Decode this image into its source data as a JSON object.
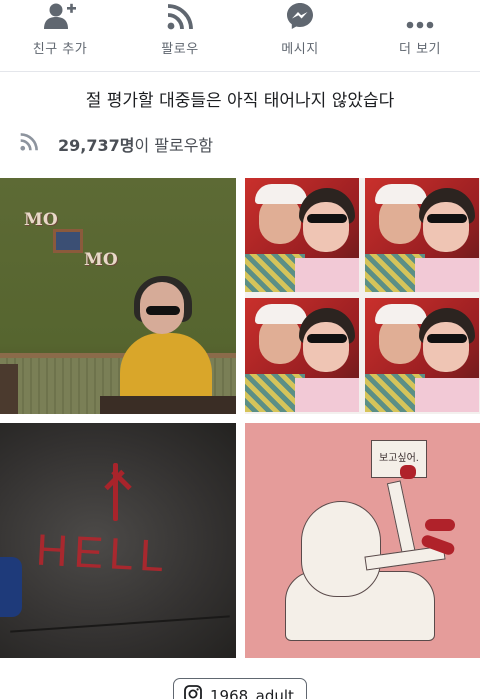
{
  "actions": [
    {
      "label": "친구 추가",
      "icon": "add-friend-icon"
    },
    {
      "label": "팔로우",
      "icon": "follow-rss-icon"
    },
    {
      "label": "메시지",
      "icon": "messenger-icon"
    },
    {
      "label": "더 보기",
      "icon": "more-dots-icon"
    }
  ],
  "page": {
    "description": "절 평가할 대중들은 아직 태어나지 않았습다"
  },
  "followers": {
    "count": "29,737명",
    "suffix": "이 팔로우함",
    "icon": "rss-icon"
  },
  "photos": {
    "p1": {
      "sign_top": "MO",
      "sign_bottom": "MO"
    },
    "p3": {
      "graffiti": "HELL"
    },
    "p4": {
      "speech_bubble": "보고싶어."
    }
  },
  "instagram_chip": {
    "label": "1968_adult",
    "icon": "instagram-icon"
  },
  "colors": {
    "icon_gray": "#606770",
    "text_dark": "#1c1e21"
  }
}
